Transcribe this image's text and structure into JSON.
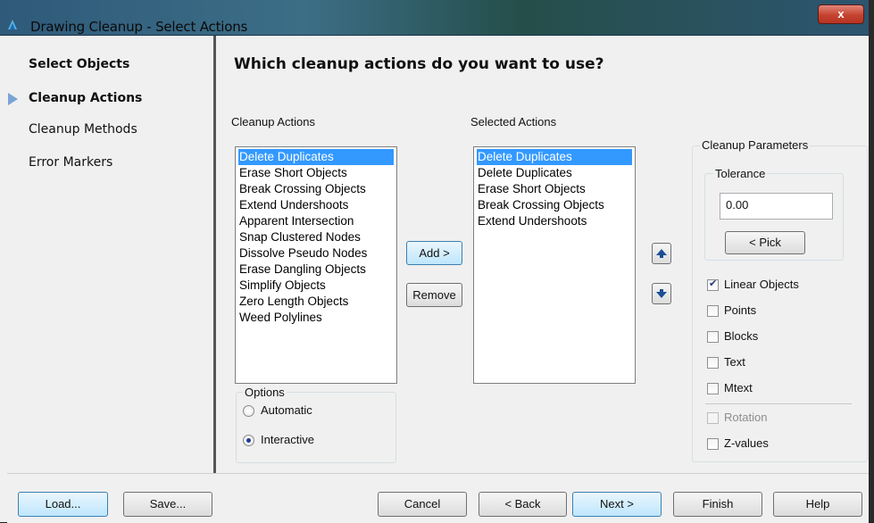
{
  "window": {
    "title": "Drawing Cleanup - Select Actions",
    "close_glyph": "x"
  },
  "nav": {
    "items": [
      {
        "label": "Select Objects"
      },
      {
        "label": "Cleanup Actions"
      },
      {
        "label": "Cleanup Methods"
      },
      {
        "label": "Error Markers"
      }
    ],
    "current_index": 1
  },
  "main": {
    "heading": "Which cleanup actions do you want to use?",
    "available_label": "Cleanup Actions",
    "selected_label": "Selected Actions",
    "available_actions": [
      "Delete Duplicates",
      "Erase Short Objects",
      "Break Crossing Objects",
      "Extend Undershoots",
      "Apparent Intersection",
      "Snap Clustered Nodes",
      "Dissolve Pseudo Nodes",
      "Erase Dangling Objects",
      "Simplify Objects",
      "Zero Length Objects",
      "Weed Polylines"
    ],
    "available_selected_index": 0,
    "selected_actions": [
      "Delete Duplicates",
      "Delete Duplicates",
      "Erase Short Objects",
      "Break Crossing Objects",
      "Extend Undershoots"
    ],
    "selected_selected_index": 0,
    "add_label": "Add >",
    "remove_label": "Remove",
    "options": {
      "title": "Options",
      "automatic_label": "Automatic",
      "interactive_label": "Interactive",
      "selected": "Interactive"
    },
    "params": {
      "title": "Cleanup Parameters",
      "tolerance_title": "Tolerance",
      "tolerance_value": "0.00",
      "pick_label": "< Pick",
      "checks": [
        {
          "label": "Linear Objects",
          "checked": true,
          "enabled": true
        },
        {
          "label": "Points",
          "checked": false,
          "enabled": true
        },
        {
          "label": "Blocks",
          "checked": false,
          "enabled": true
        },
        {
          "label": "Text",
          "checked": false,
          "enabled": true
        },
        {
          "label": "Mtext",
          "checked": false,
          "enabled": true
        },
        {
          "label": "Rotation",
          "checked": false,
          "enabled": false
        },
        {
          "label": "Z-values",
          "checked": false,
          "enabled": true
        }
      ]
    }
  },
  "footer": {
    "load_label": "Load...",
    "save_label": "Save...",
    "cancel_label": "Cancel",
    "back_label": "< Back",
    "next_label": "Next >",
    "finish_label": "Finish",
    "help_label": "Help"
  },
  "colors": {
    "selection": "#3399ff",
    "nav_arrow": "#7aa4d6",
    "close": "#c4432f"
  },
  "icons": {
    "app": "autocad-map-icon",
    "up": "up-arrow-icon",
    "down": "down-arrow-icon"
  }
}
